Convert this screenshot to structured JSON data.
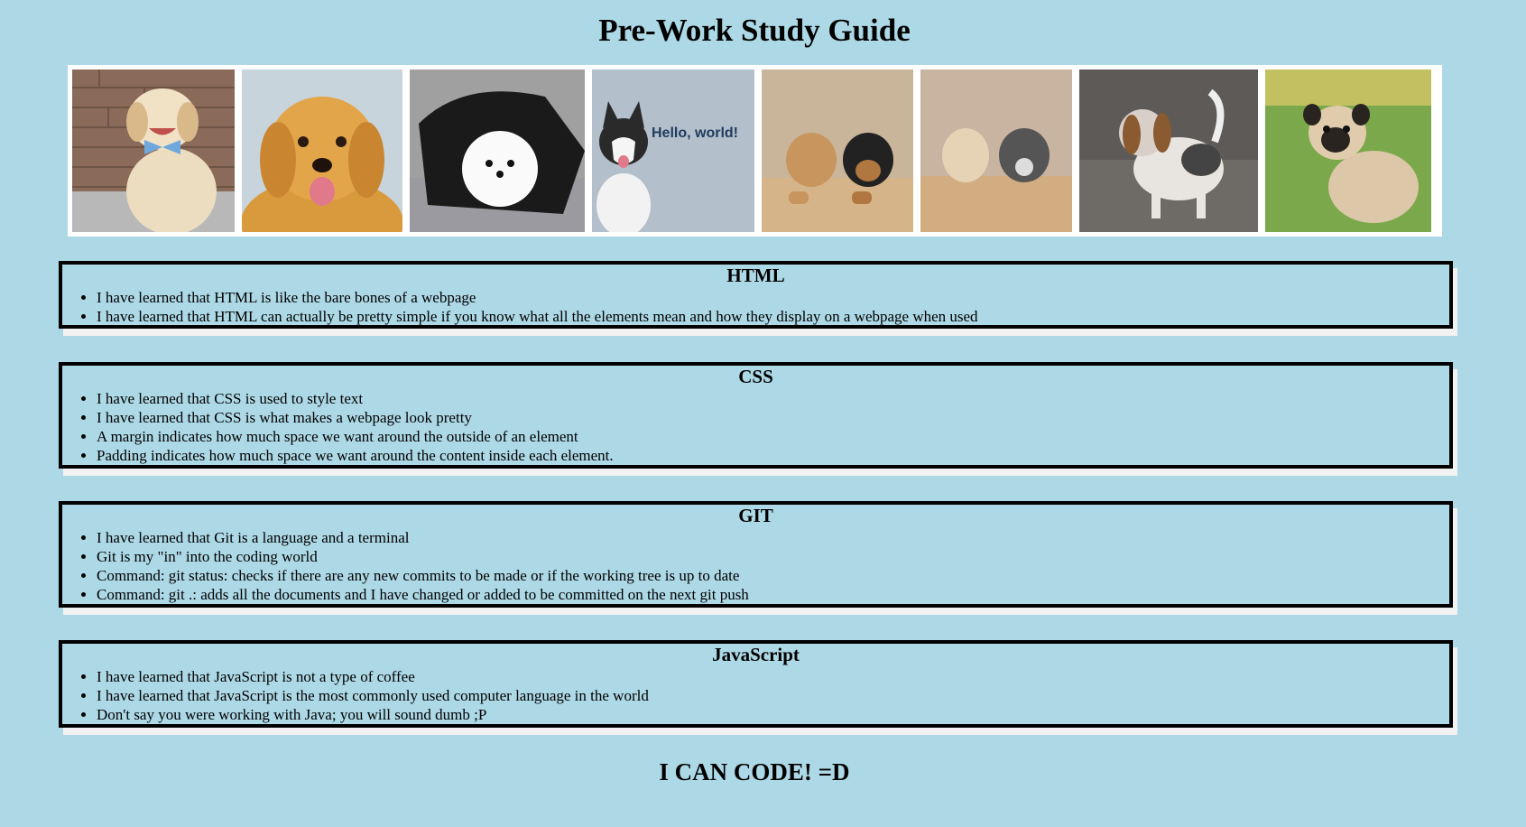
{
  "page": {
    "title": "Pre-Work Study Guide",
    "background": "#add8e6",
    "footer": "I CAN CODE! =D"
  },
  "gallery": {
    "photos": [
      {
        "subject": "puppy-bowtie-photo"
      },
      {
        "subject": "golden-retriever-puppy-photo"
      },
      {
        "subject": "white-pomeranian-puppy-photo"
      },
      {
        "subject": "husky-puppy-photo",
        "caption": "Hello, world!"
      },
      {
        "subject": "two-puppies-in-box-photo"
      },
      {
        "subject": "two-puppies-in-crate-photo"
      },
      {
        "subject": "beagle-puppy-photo"
      },
      {
        "subject": "pug-puppy-photo"
      }
    ]
  },
  "sections": [
    {
      "heading": "HTML",
      "items": [
        "I have learned that HTML is like the bare bones of a webpage",
        "I have learned that HTML can actually be pretty simple if you know what all the elements mean and how they display on a webpage when used"
      ]
    },
    {
      "heading": "CSS",
      "items": [
        "I have learned that CSS is used to style text",
        "I have learned that CSS is what makes a webpage look pretty",
        "A margin indicates how much space we want around the outside of an element",
        "Padding indicates how much space we want around the content inside each element."
      ]
    },
    {
      "heading": "GIT",
      "items": [
        "I have learned that Git is a language and a terminal",
        "Git is my \"in\" into the coding world",
        "Command: git status: checks if there are any new commits to be made or if the working tree is up to date",
        "Command: git .: adds all the documents and I have changed or added to be committed on the next git push"
      ]
    },
    {
      "heading": "JavaScript",
      "items": [
        "I have learned that JavaScript is not a type of coffee",
        "I have learned that JavaScript is the most commonly used computer language in the world",
        "Don't say you were working with Java; you will sound dumb ;P"
      ]
    }
  ]
}
